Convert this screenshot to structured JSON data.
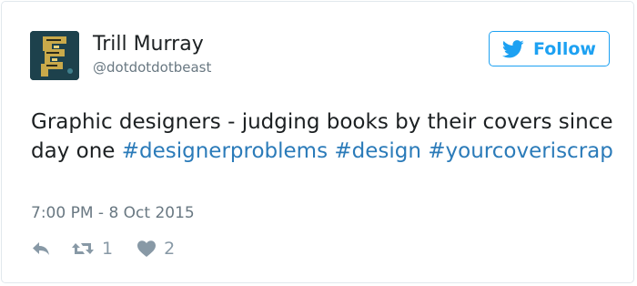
{
  "user": {
    "name": "Trill Murray",
    "handle": "@dotdotdotbeast"
  },
  "follow_button": {
    "label": "Follow",
    "icon": "twitter-bird-icon"
  },
  "tweet": {
    "text_before": "Graphic designers - judging books by their covers since day one ",
    "hashtags": [
      "#designerproblems",
      "#design",
      "#yourcoveriscrap"
    ],
    "timestamp": "7:00 PM - 8 Oct 2015"
  },
  "actions": {
    "reply_icon": "reply-icon",
    "retweet_icon": "retweet-icon",
    "retweet_count": "1",
    "like_icon": "heart-icon",
    "like_count": "2"
  },
  "colors": {
    "accent": "#1da1f2",
    "hashtag": "#2b7bb9",
    "text": "#1c2022",
    "muted": "#697882",
    "border": "#e1e8ed"
  }
}
